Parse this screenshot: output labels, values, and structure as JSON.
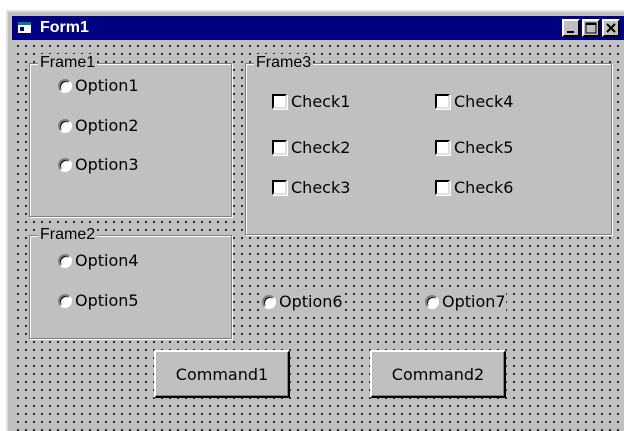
{
  "window": {
    "title": "Form1",
    "controls": {
      "minimize": "minimize-icon",
      "maximize": "maximize-icon",
      "close": "close-icon"
    },
    "colors": {
      "titlebar": "#000080",
      "face": "#c0c0c0"
    }
  },
  "frame1": {
    "caption": "Frame1",
    "options": [
      "Option1",
      "Option2",
      "Option3"
    ]
  },
  "frame2": {
    "caption": "Frame2",
    "options": [
      "Option4",
      "Option5"
    ]
  },
  "frame3": {
    "caption": "Frame3",
    "checks": [
      "Check1",
      "Check2",
      "Check3",
      "Check4",
      "Check5",
      "Check6"
    ]
  },
  "loose_options": [
    "Option6",
    "Option7"
  ],
  "buttons": {
    "command1": "Command1",
    "command2": "Command2"
  }
}
